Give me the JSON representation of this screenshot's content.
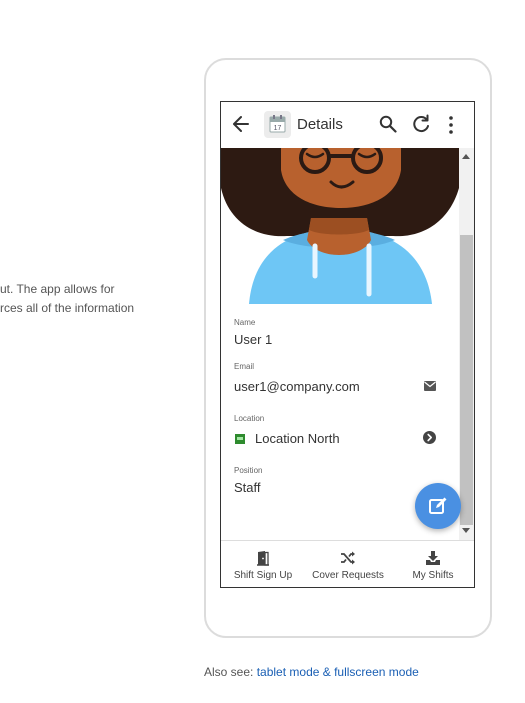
{
  "background_text": {
    "line1": "ut. The app allows for",
    "line2": "rces all of the information"
  },
  "app": {
    "title": "Details",
    "calendar_icon_day": "17",
    "icons": [
      "back-arrow-icon",
      "calendar-icon",
      "search-icon",
      "refresh-icon",
      "more-vert-icon"
    ]
  },
  "details": {
    "name_label": "Name",
    "name_value": "User 1",
    "email_label": "Email",
    "email_value": "user1@company.com",
    "location_label": "Location",
    "location_value": "Location North",
    "position_label": "Position",
    "position_value": "Staff"
  },
  "bottom_nav": [
    {
      "label": "Shift Sign Up",
      "icon": "door-icon"
    },
    {
      "label": "Cover Requests",
      "icon": "shuffle-icon"
    },
    {
      "label": "My Shifts",
      "icon": "inbox-download-icon"
    }
  ],
  "footer": {
    "prefix": "Also see: ",
    "link": "tablet mode & fullscreen mode"
  },
  "colors": {
    "accent": "#4a90e2",
    "link": "#1a5fb4",
    "skin": "#b8612e",
    "hair": "#2d1a12",
    "shirt": "#6ec6f5"
  }
}
